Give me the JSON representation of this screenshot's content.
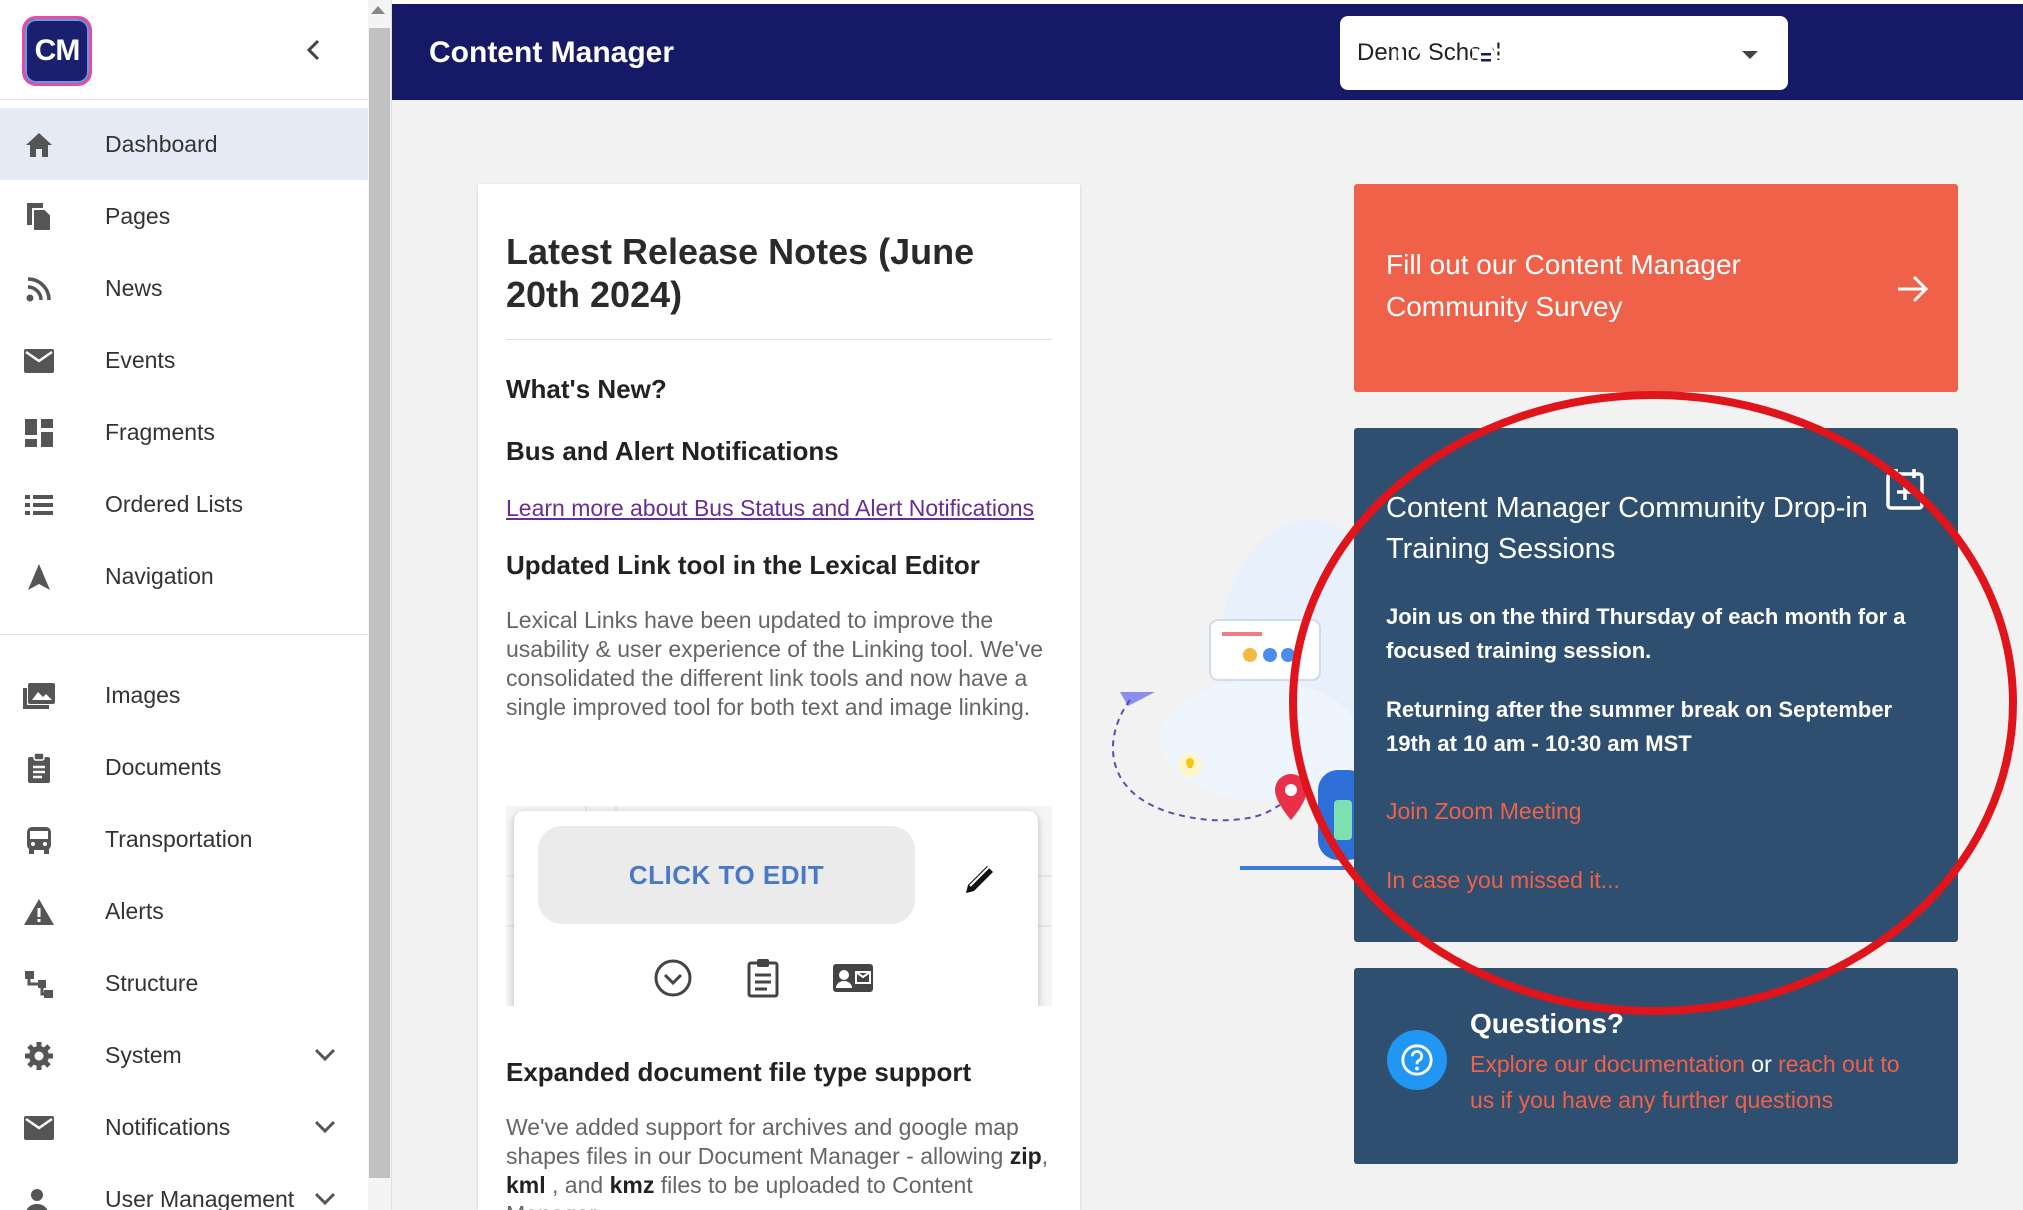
{
  "sidebar": {
    "logo_text": "CM",
    "items_primary": [
      {
        "label": "Dashboard",
        "icon": "home-icon",
        "active": true
      },
      {
        "label": "Pages",
        "icon": "pages-icon"
      },
      {
        "label": "News",
        "icon": "rss-icon"
      },
      {
        "label": "Events",
        "icon": "mail-icon"
      },
      {
        "label": "Fragments",
        "icon": "dashboard-grid-icon"
      },
      {
        "label": "Ordered Lists",
        "icon": "list-icon"
      },
      {
        "label": "Navigation",
        "icon": "navigation-arrow-icon"
      }
    ],
    "items_secondary": [
      {
        "label": "Images",
        "icon": "images-icon"
      },
      {
        "label": "Documents",
        "icon": "clipboard-icon"
      },
      {
        "label": "Transportation",
        "icon": "bus-icon"
      },
      {
        "label": "Alerts",
        "icon": "warning-icon"
      },
      {
        "label": "Structure",
        "icon": "structure-icon"
      },
      {
        "label": "System",
        "icon": "gear-icon",
        "expandable": true
      },
      {
        "label": "Notifications",
        "icon": "mail-icon",
        "expandable": true
      },
      {
        "label": "User Management",
        "icon": "user-icon",
        "expandable": true
      }
    ]
  },
  "topbar": {
    "title": "Content Manager",
    "school_selected": "Demo School"
  },
  "notes": {
    "title": "Latest Release Notes (June 20th 2024)",
    "whats_new": "What's New?",
    "section1_heading": "Bus and Alert Notifications",
    "section1_link": "Learn more about Bus Status and Alert Notifications",
    "section2_heading": "Updated Link tool in the Lexical Editor",
    "section2_body": "Lexical Links have been updated to improve the usability & user experience of the Linking tool. We've consolidated the different link tools and now have a single improved tool for both text and image linking.",
    "click_to_edit": "CLICK TO EDIT",
    "section3_heading": "Expanded document file type support",
    "section3_body_a": "We've added support for archives and google map shapes files in our Document Manager - allowing ",
    "section3_zip": "zip",
    "section3_sep1": ", ",
    "section3_kml": "kml",
    "section3_sep2": " , and ",
    "section3_kmz": "kmz",
    "section3_body_b": " files to be uploaded to Content Manager."
  },
  "survey": {
    "text": "Fill out our Content Manager Community Survey"
  },
  "training": {
    "title": "Content Manager Community Drop-in Training Sessions",
    "para1": "Join us on the third Thursday of each month for a focused training session.",
    "para2": "Returning after the summer break on September 19th at 10 am - 10:30 am MST",
    "link1": "Join Zoom Meeting",
    "link2": "In case you missed it..."
  },
  "questions": {
    "title": "Questions?",
    "link1": "Explore our documentation",
    "middle": " or ",
    "link2": "reach out to us if you have any further questions"
  },
  "colors": {
    "topbar": "#161a66",
    "survey": "#ef6149",
    "card_dark": "#2e4f70",
    "annotation_ring": "#e0141b"
  }
}
